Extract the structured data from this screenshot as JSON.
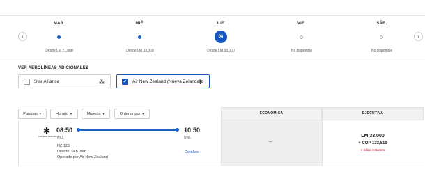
{
  "date_strip": {
    "days": [
      {
        "name": "MAR.",
        "price": "Desde LM 21,000",
        "state": "available"
      },
      {
        "name": "MIÉ.",
        "price": "Desde LM 33,000",
        "state": "available"
      },
      {
        "name": "JUE.",
        "price": "Desde LM 33,000",
        "state": "selected",
        "number": "08"
      },
      {
        "name": "VIE.",
        "price": "No disponible",
        "state": "unavailable"
      },
      {
        "name": "SÁB.",
        "price": "No disponible",
        "state": "unavailable"
      }
    ],
    "prev_icon": "‹",
    "next_icon": "›"
  },
  "additional_airlines": {
    "title": "VER AEROLÍNEAS ADICIONALES",
    "options": [
      {
        "label": "Star Alliance",
        "checked": false,
        "logo": "⁂"
      },
      {
        "label": "Air New Zealand (Nueva Zelanda)",
        "checked": true,
        "logo": "✻"
      }
    ]
  },
  "filters": {
    "stops": "Paradas",
    "schedule": "Horario",
    "currency": "Moneda",
    "sort": "Ordenar por"
  },
  "cabins": {
    "economy": "ECONÓMICA",
    "business": "EJECUTIVA"
  },
  "flight": {
    "logo_text": "AIR NEW ZEALAND",
    "departure_time": "08:50",
    "departure_airport": "AKL",
    "arrival_time": "10:50",
    "arrival_airport": "NNL",
    "flight_number": "NZ 123",
    "duration": "Directo, 04h 00m",
    "operated_by": "Operado por Air New Zealand",
    "details_link": "Detalles",
    "economy_price": "--",
    "business_price_miles": "LM 33,000",
    "business_price_cash": "+ COP 133,819",
    "seats_left": "6 Sillas restantes"
  },
  "colors": {
    "accent": "#1557bf",
    "warning": "#d0021b"
  }
}
